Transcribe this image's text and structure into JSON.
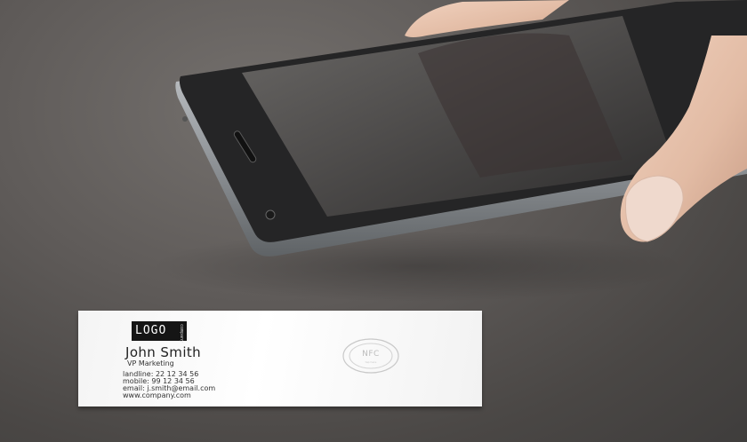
{
  "scene": {
    "description_colors": {
      "surface": "#5f5b59",
      "phone_body": "#2a2a2a",
      "phone_frame": "#b9bcbf",
      "card": "#ffffff",
      "skin": "#e8c4ae"
    }
  },
  "card": {
    "logo_text": "LOGO",
    "logo_sub": "company",
    "name": "John Smith",
    "role": "VP Marketing",
    "landline": "landline: 22 12 34 56",
    "mobile": "mobile: 99 12 34 56",
    "email": "email: j.smith@email.com",
    "website": "www.company.com",
    "nfc_label": "NFC",
    "nfc_sub": "tap here"
  }
}
